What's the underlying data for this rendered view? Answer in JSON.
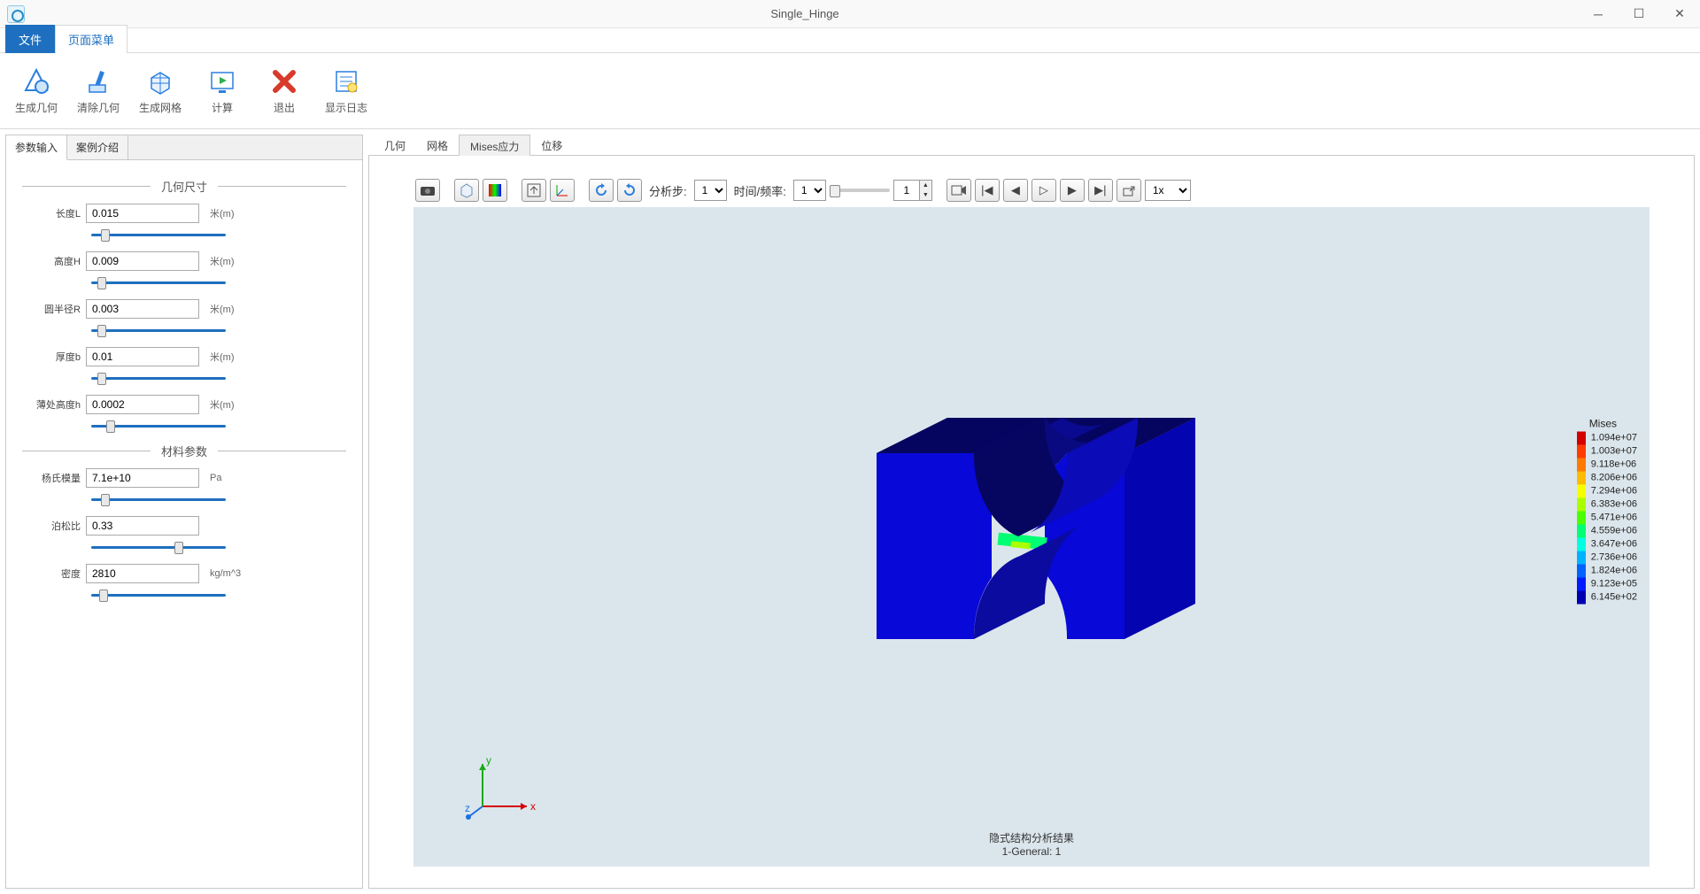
{
  "window": {
    "title": "Single_Hinge"
  },
  "menubar": {
    "file": "文件",
    "page": "页面菜单"
  },
  "ribbon": [
    {
      "name": "gen-geom",
      "label": "生成几何"
    },
    {
      "name": "clear-geom",
      "label": "清除几何"
    },
    {
      "name": "gen-mesh",
      "label": "生成网格"
    },
    {
      "name": "compute",
      "label": "计算"
    },
    {
      "name": "exit",
      "label": "退出"
    },
    {
      "name": "show-log",
      "label": "显示日志"
    }
  ],
  "left_tabs": {
    "params": "参数输入",
    "intro": "案例介绍"
  },
  "sections": {
    "geom": "几何尺寸",
    "material": "材料参数"
  },
  "params": {
    "length": {
      "label": "长度L",
      "value": "0.015",
      "unit": "米(m)"
    },
    "height": {
      "label": "高度H",
      "value": "0.009",
      "unit": "米(m)"
    },
    "radius": {
      "label": "圆半径R",
      "value": "0.003",
      "unit": "米(m)"
    },
    "thickness": {
      "label": "厚度b",
      "value": "0.01",
      "unit": "米(m)"
    },
    "thin_h": {
      "label": "薄处高度h",
      "value": "0.0002",
      "unit": "米(m)"
    },
    "youngs": {
      "label": "杨氏模量",
      "value": "7.1e+10",
      "unit": "Pa"
    },
    "poisson": {
      "label": "泊松比",
      "value": "0.33",
      "unit": ""
    },
    "density": {
      "label": "密度",
      "value": "2810",
      "unit": "kg/m^3"
    }
  },
  "result_tabs": {
    "geom": "几何",
    "mesh": "网格",
    "mises": "Mises应力",
    "disp": "位移"
  },
  "viewer_toolbar": {
    "step_label": "分析步:",
    "step_value": "1",
    "freq_label": "时间/频率:",
    "freq_value": "1",
    "frame_value": "1",
    "speed_value": "1x"
  },
  "result_caption": {
    "line1": "隐式结构分析结果",
    "line2": "1-General: 1"
  },
  "legend": {
    "title": "Mises",
    "items": [
      {
        "color": "#d40000",
        "value": "1.094e+07"
      },
      {
        "color": "#ff3b00",
        "value": "1.003e+07"
      },
      {
        "color": "#ff7a00",
        "value": "9.118e+06"
      },
      {
        "color": "#ffbb00",
        "value": "8.206e+06"
      },
      {
        "color": "#f6ff00",
        "value": "7.294e+06"
      },
      {
        "color": "#a9ff00",
        "value": "6.383e+06"
      },
      {
        "color": "#4cff00",
        "value": "5.471e+06"
      },
      {
        "color": "#00ff73",
        "value": "4.559e+06"
      },
      {
        "color": "#00ffe1",
        "value": "3.647e+06"
      },
      {
        "color": "#00b3ff",
        "value": "2.736e+06"
      },
      {
        "color": "#0062ff",
        "value": "1.824e+06"
      },
      {
        "color": "#001bff",
        "value": "9.123e+05"
      },
      {
        "color": "#0000b3",
        "value": "6.145e+02"
      }
    ]
  },
  "axes": {
    "x": "x",
    "y": "y",
    "z": "z"
  }
}
